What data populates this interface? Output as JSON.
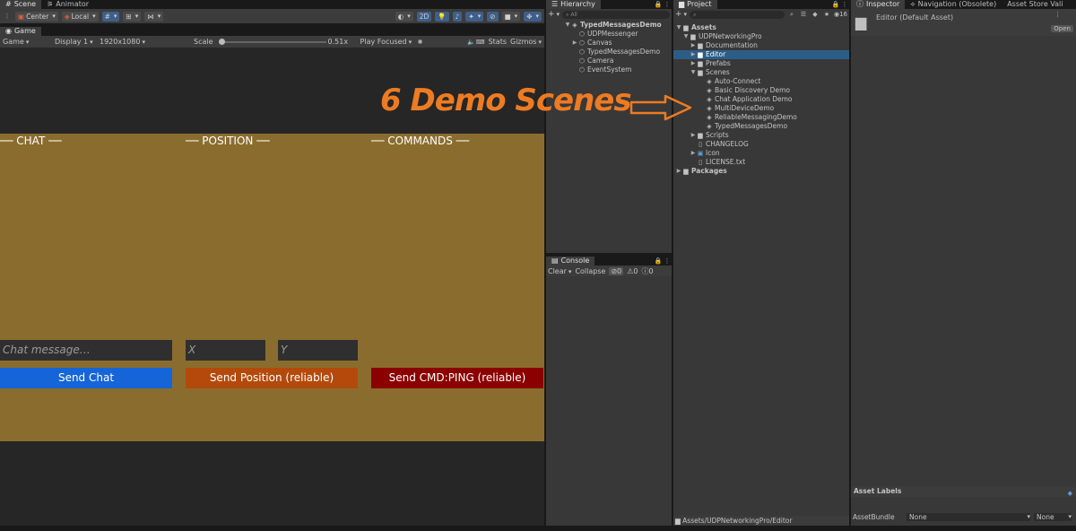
{
  "scene_tabs": [
    {
      "label": "Scene",
      "icon": "scene-icon"
    },
    {
      "label": "Animator",
      "icon": "animator-icon"
    }
  ],
  "scene_toolbar": {
    "pivot": "Center",
    "space": "Local",
    "mode_2d": "2D"
  },
  "game": {
    "tab": "Game",
    "view": "Game",
    "display": "Display 1",
    "resolution": "1920x1080",
    "scale_label": "Scale",
    "scale_value": 0.51,
    "scale_text": "0.51x",
    "play_mode": "Play Focused",
    "stats": "Stats",
    "gizmos": "Gizmos"
  },
  "demo_ui": {
    "chat_header": "── CHAT ──",
    "position_header": "── POSITION ──",
    "commands_header": "── COMMANDS ──",
    "chat_placeholder": "Chat message…",
    "x_placeholder": "X",
    "y_placeholder": "Y",
    "send_chat": "Send Chat",
    "send_position": "Send Position (reliable)",
    "send_cmd": "Send CMD:PING (reliable)"
  },
  "colors": {
    "canvas_bg": "#8a6d2e",
    "send_chat_btn": "#1565d8",
    "send_position_btn": "#b34a0c",
    "send_cmd_btn": "#8b0000",
    "annotation": "#ee7b22",
    "selection": "#2c5d87"
  },
  "annotation": "6 Demo Scenes",
  "hierarchy": {
    "tab": "Hierarchy",
    "search_placeholder": "All",
    "scene_name": "TypedMessagesDemo",
    "items": [
      "UDPMessenger",
      "Canvas",
      "TypedMessagesDemo",
      "Camera",
      "EventSystem"
    ]
  },
  "console": {
    "tab": "Console",
    "clear": "Clear",
    "collapse": "Collapse",
    "errors": "0",
    "warnings": "0",
    "info": "0"
  },
  "project": {
    "tab": "Project",
    "count": "16",
    "assets": "Assets",
    "root": "UDPNetworkingPro",
    "folders": [
      "Documentation",
      "Editor",
      "Prefabs"
    ],
    "scenes_folder": "Scenes",
    "scenes": [
      "Auto-Connect",
      "Basic Discovery Demo",
      "Chat Application Demo",
      "MultiDeviceDemo",
      "ReliableMessagingDemo",
      "TypedMessagesDemo"
    ],
    "after": [
      {
        "label": "Scripts",
        "icon": "folder-icon",
        "fold": true
      },
      {
        "label": "CHANGELOG",
        "icon": "text-file-icon",
        "fold": false
      },
      {
        "label": "Icon",
        "icon": "image-icon",
        "fold": true
      },
      {
        "label": "LICENSE.txt",
        "icon": "text-file-icon",
        "fold": false
      }
    ],
    "packages": "Packages",
    "path": "Assets/UDPNetworkingPro/Editor"
  },
  "inspector": {
    "tabs": [
      "Inspector",
      "Navigation (Obsolete)",
      "Asset Store Vali"
    ],
    "title": "Editor (Default Asset)",
    "open": "Open",
    "asset_labels": "Asset Labels",
    "asset_bundle": "AssetBundle",
    "bundle_value": "None",
    "variant_value": "None"
  }
}
